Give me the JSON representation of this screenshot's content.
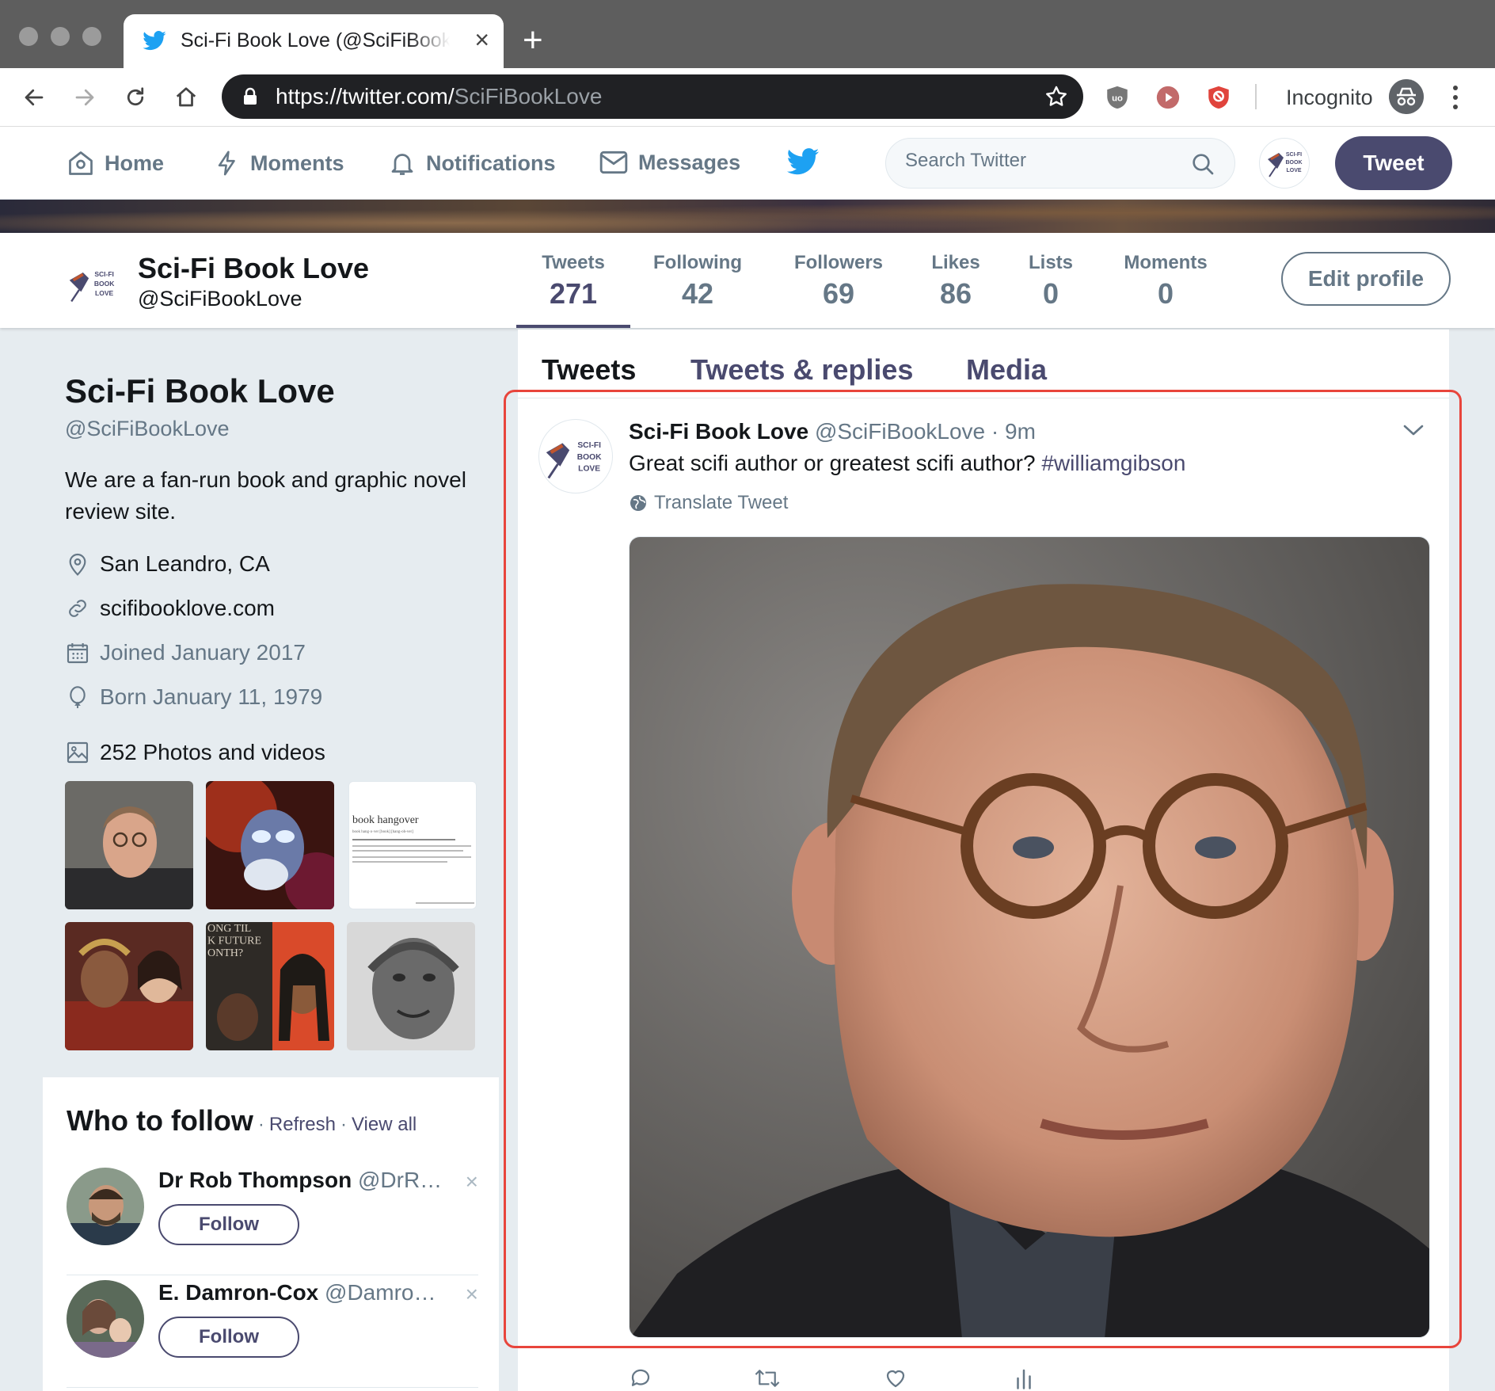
{
  "browser": {
    "tab_title": "Sci-Fi Book Love (@SciFiBookLove) | Twitter",
    "url_host": "https://twitter.com/",
    "url_path": "SciFiBookLove",
    "mode_label": "Incognito"
  },
  "nav": {
    "home": "Home",
    "moments": "Moments",
    "notifications": "Notifications",
    "messages": "Messages",
    "search_placeholder": "Search Twitter",
    "tweet_button": "Tweet"
  },
  "profile_bar": {
    "name": "Sci-Fi Book Love",
    "handle": "@SciFiBookLove",
    "stats": [
      {
        "label": "Tweets",
        "value": "271"
      },
      {
        "label": "Following",
        "value": "42"
      },
      {
        "label": "Followers",
        "value": "69"
      },
      {
        "label": "Likes",
        "value": "86"
      },
      {
        "label": "Lists",
        "value": "0"
      },
      {
        "label": "Moments",
        "value": "0"
      }
    ],
    "edit_button": "Edit profile"
  },
  "profile": {
    "name": "Sci-Fi Book Love",
    "handle": "@SciFiBookLove",
    "bio": "We are a fan-run book and graphic novel review site.",
    "location": "San Leandro, CA",
    "website": "scifibooklove.com",
    "joined": "Joined January 2017",
    "born": "Born January 11, 1979",
    "photos_link": "252 Photos and videos",
    "thumb_text": {
      "book_title": "book hangover",
      "book_line": "book hang·o·ver  [book] [hang-oh-ver]",
      "poster_text": "ONG TIL\nK FUTURE\nONTH?"
    },
    "logo_text": "SCI-FI BOOK LOVE"
  },
  "who_to_follow": {
    "title": "Who to follow",
    "refresh": "Refresh",
    "view_all": "View all",
    "suggestions": [
      {
        "name": "Dr Rob Thompson",
        "handle": "@DrR…",
        "button": "Follow"
      },
      {
        "name": "E. Damron-Cox",
        "handle": "@Damro…",
        "button": "Follow"
      }
    ]
  },
  "timeline": {
    "tabs": [
      "Tweets",
      "Tweets & replies",
      "Media"
    ],
    "tweet": {
      "name": "Sci-Fi Book Love",
      "handle": "@SciFiBookLove",
      "time": "· 9m",
      "text": "Great scifi author or greatest scifi author?",
      "hashtag": "#williamgibson",
      "translate": "Translate Tweet"
    }
  },
  "colors": {
    "accent": "#4a4a6f",
    "muted": "#657786",
    "highlight_border": "#e8453c",
    "background": "#e6ecf0"
  }
}
